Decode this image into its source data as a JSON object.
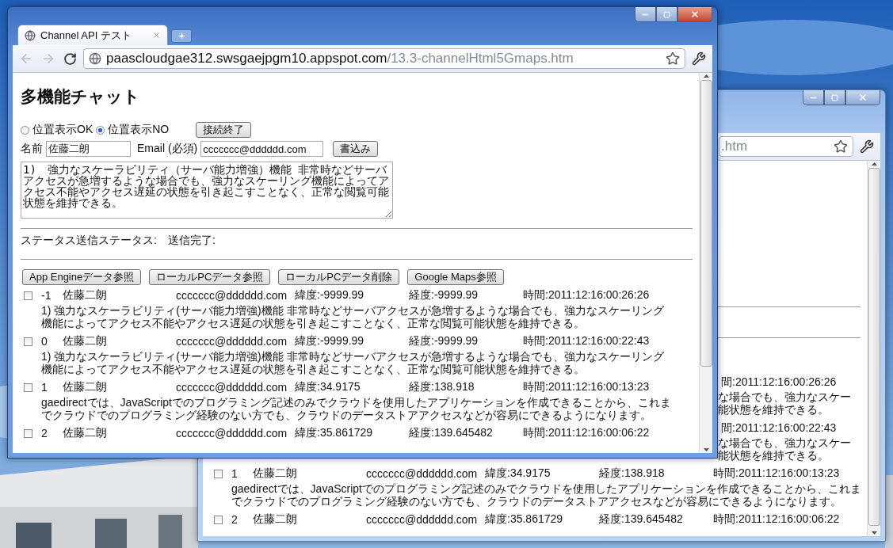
{
  "back_window": {
    "url_fragment": ".htm",
    "partial_rows": [
      {
        "time": "間:2011:12:16:00:26:26",
        "lines": [
          "な場合でも、強力なスケー",
          "能状態を維持できる。"
        ]
      },
      {
        "time": "間:2011:12:16:00:22:43",
        "lines": [
          "な場合でも、強力なスケー",
          "能状態を維持できる。"
        ]
      }
    ],
    "rows": [
      {
        "checked": false,
        "id": "1",
        "name": "佐藤二朗",
        "email": "ccccccc@dddddd.com",
        "lat": "緯度:34.9175",
        "lon": "経度:138.918",
        "time": "時間:2011:12:16:00:13:23",
        "body": "gaedirectでは、JavaScriptでのプログラミング記述のみでクラウドを使用したアプリケーションを作成できることから、これまでクラウドでのプログラミング経験のない方でも、クラウドのデータストアアクセスなどが容易にできるようになります。"
      },
      {
        "checked": false,
        "id": "2",
        "name": "佐藤二朗",
        "email": "ccccccc@dddddd.com",
        "lat": "緯度:35.861729",
        "lon": "経度:139.645482",
        "time": "時間:2011:12:16:00:06:22"
      }
    ]
  },
  "window": {
    "tab_title": "Channel API テスト",
    "url_host": "paascloudgae312.swsgaejpgm10.appspot.com",
    "url_path": "/13.3-channelHtml5Gmaps.htm",
    "page": {
      "title": "多機能チャット",
      "radios": [
        {
          "label": "位置表示OK",
          "selected": false
        },
        {
          "label": "位置表示NO",
          "selected": true
        }
      ],
      "end_button": "接続終了",
      "name_label": "名前",
      "name_value": "佐藤二朗",
      "email_label": "Email (必須)",
      "email_value": "ccccccc@dddddd.com",
      "write_button": "書込み",
      "message": "1)　強力なスケーラビリティ（サーバ能力増強）機能 非常時などサーバアクセスが急増するような場合でも、強力なスケーリング機能によってアクセス不能やアクセス遅延の状態を引き起こすことなく、正常な閲覧可能状態を維持できる。",
      "status": "ステータス送信ステータス:　送信完了:",
      "buttons": [
        "App Engineデータ参照",
        "ローカルPCデータ参照",
        "ローカルPCデータ削除",
        "Google Maps参照"
      ],
      "rows": [
        {
          "checked": false,
          "id": "-1",
          "name": "佐藤二朗",
          "email": "ccccccc@dddddd.com",
          "lat": "緯度:-9999.99",
          "lon": "経度:-9999.99",
          "time": "時間:2011:12:16:00:26:26",
          "body": "1) 強力なスケーラビリティ(サーバ能力増強)機能 非常時などサーバアクセスが急増するような場合でも、強力なスケーリング機能によってアクセス不能やアクセス遅延の状態を引き起こすことなく、正常な閲覧可能状態を維持できる。"
        },
        {
          "checked": false,
          "id": "0",
          "name": "佐藤二朗",
          "email": "ccccccc@dddddd.com",
          "lat": "緯度:-9999.99",
          "lon": "経度:-9999.99",
          "time": "時間:2011:12:16:00:22:43",
          "body": "1) 強力なスケーラビリティ(サーバ能力増強)機能 非常時などサーバアクセスが急増するような場合でも、強力なスケーリング機能によってアクセス不能やアクセス遅延の状態を引き起こすことなく、正常な閲覧可能状態を維持できる。"
        },
        {
          "checked": false,
          "id": "1",
          "name": "佐藤二朗",
          "email": "ccccccc@dddddd.com",
          "lat": "緯度:34.9175",
          "lon": "経度:138.918",
          "time": "時間:2011:12:16:00:13:23",
          "body": "gaedirectでは、JavaScriptでのプログラミング記述のみでクラウドを使用したアプリケーションを作成できることから、これまでクラウドでのプログラミング経験のない方でも、クラウドのデータストアアクセスなどが容易にできるようになります。"
        },
        {
          "checked": false,
          "id": "2",
          "name": "佐藤二朗",
          "email": "ccccccc@dddddd.com",
          "lat": "緯度:35.861729",
          "lon": "経度:139.645482",
          "time": "時間:2011:12:16:00:06:22"
        }
      ]
    }
  }
}
